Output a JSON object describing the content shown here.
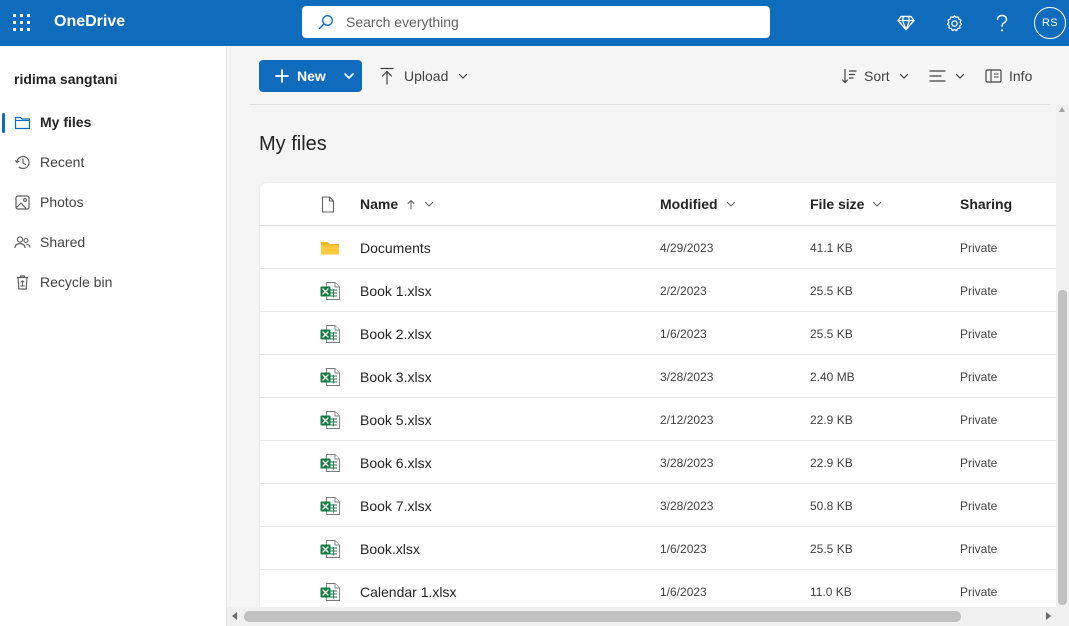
{
  "app": {
    "brand": "OneDrive",
    "accent": "#0f6cbd"
  },
  "search": {
    "placeholder": "Search everything"
  },
  "header_icons": [
    "premium-diamond-icon",
    "gear-icon",
    "help-icon"
  ],
  "avatar": {
    "initials": "RS"
  },
  "sidebar": {
    "user": "ridima sangtani",
    "items": [
      {
        "label": "My files",
        "icon": "folder-icon",
        "active": true
      },
      {
        "label": "Recent",
        "icon": "history-icon",
        "active": false
      },
      {
        "label": "Photos",
        "icon": "photo-icon",
        "active": false
      },
      {
        "label": "Shared",
        "icon": "people-icon",
        "active": false
      },
      {
        "label": "Recycle bin",
        "icon": "recycle-bin-icon",
        "active": false
      }
    ]
  },
  "toolbar": {
    "new_label": "New",
    "upload_label": "Upload",
    "sort_label": "Sort",
    "info_label": "Info"
  },
  "page": {
    "title": "My files"
  },
  "table": {
    "columns": {
      "name": "Name",
      "modified": "Modified",
      "size": "File size",
      "sharing": "Sharing"
    },
    "rows": [
      {
        "type": "folder",
        "name": "Documents",
        "modified": "4/29/2023",
        "size": "41.1 KB",
        "sharing": "Private"
      },
      {
        "type": "excel",
        "name": "Book 1.xlsx",
        "modified": "2/2/2023",
        "size": "25.5 KB",
        "sharing": "Private"
      },
      {
        "type": "excel",
        "name": "Book 2.xlsx",
        "modified": "1/6/2023",
        "size": "25.5 KB",
        "sharing": "Private"
      },
      {
        "type": "excel",
        "name": "Book 3.xlsx",
        "modified": "3/28/2023",
        "size": "2.40 MB",
        "sharing": "Private"
      },
      {
        "type": "excel",
        "name": "Book 5.xlsx",
        "modified": "2/12/2023",
        "size": "22.9 KB",
        "sharing": "Private"
      },
      {
        "type": "excel",
        "name": "Book 6.xlsx",
        "modified": "3/28/2023",
        "size": "22.9 KB",
        "sharing": "Private"
      },
      {
        "type": "excel",
        "name": "Book 7.xlsx",
        "modified": "3/28/2023",
        "size": "50.8 KB",
        "sharing": "Private"
      },
      {
        "type": "excel",
        "name": "Book.xlsx",
        "modified": "1/6/2023",
        "size": "25.5 KB",
        "sharing": "Private"
      },
      {
        "type": "excel",
        "name": "Calendar 1.xlsx",
        "modified": "1/6/2023",
        "size": "11.0 KB",
        "sharing": "Private"
      }
    ]
  }
}
